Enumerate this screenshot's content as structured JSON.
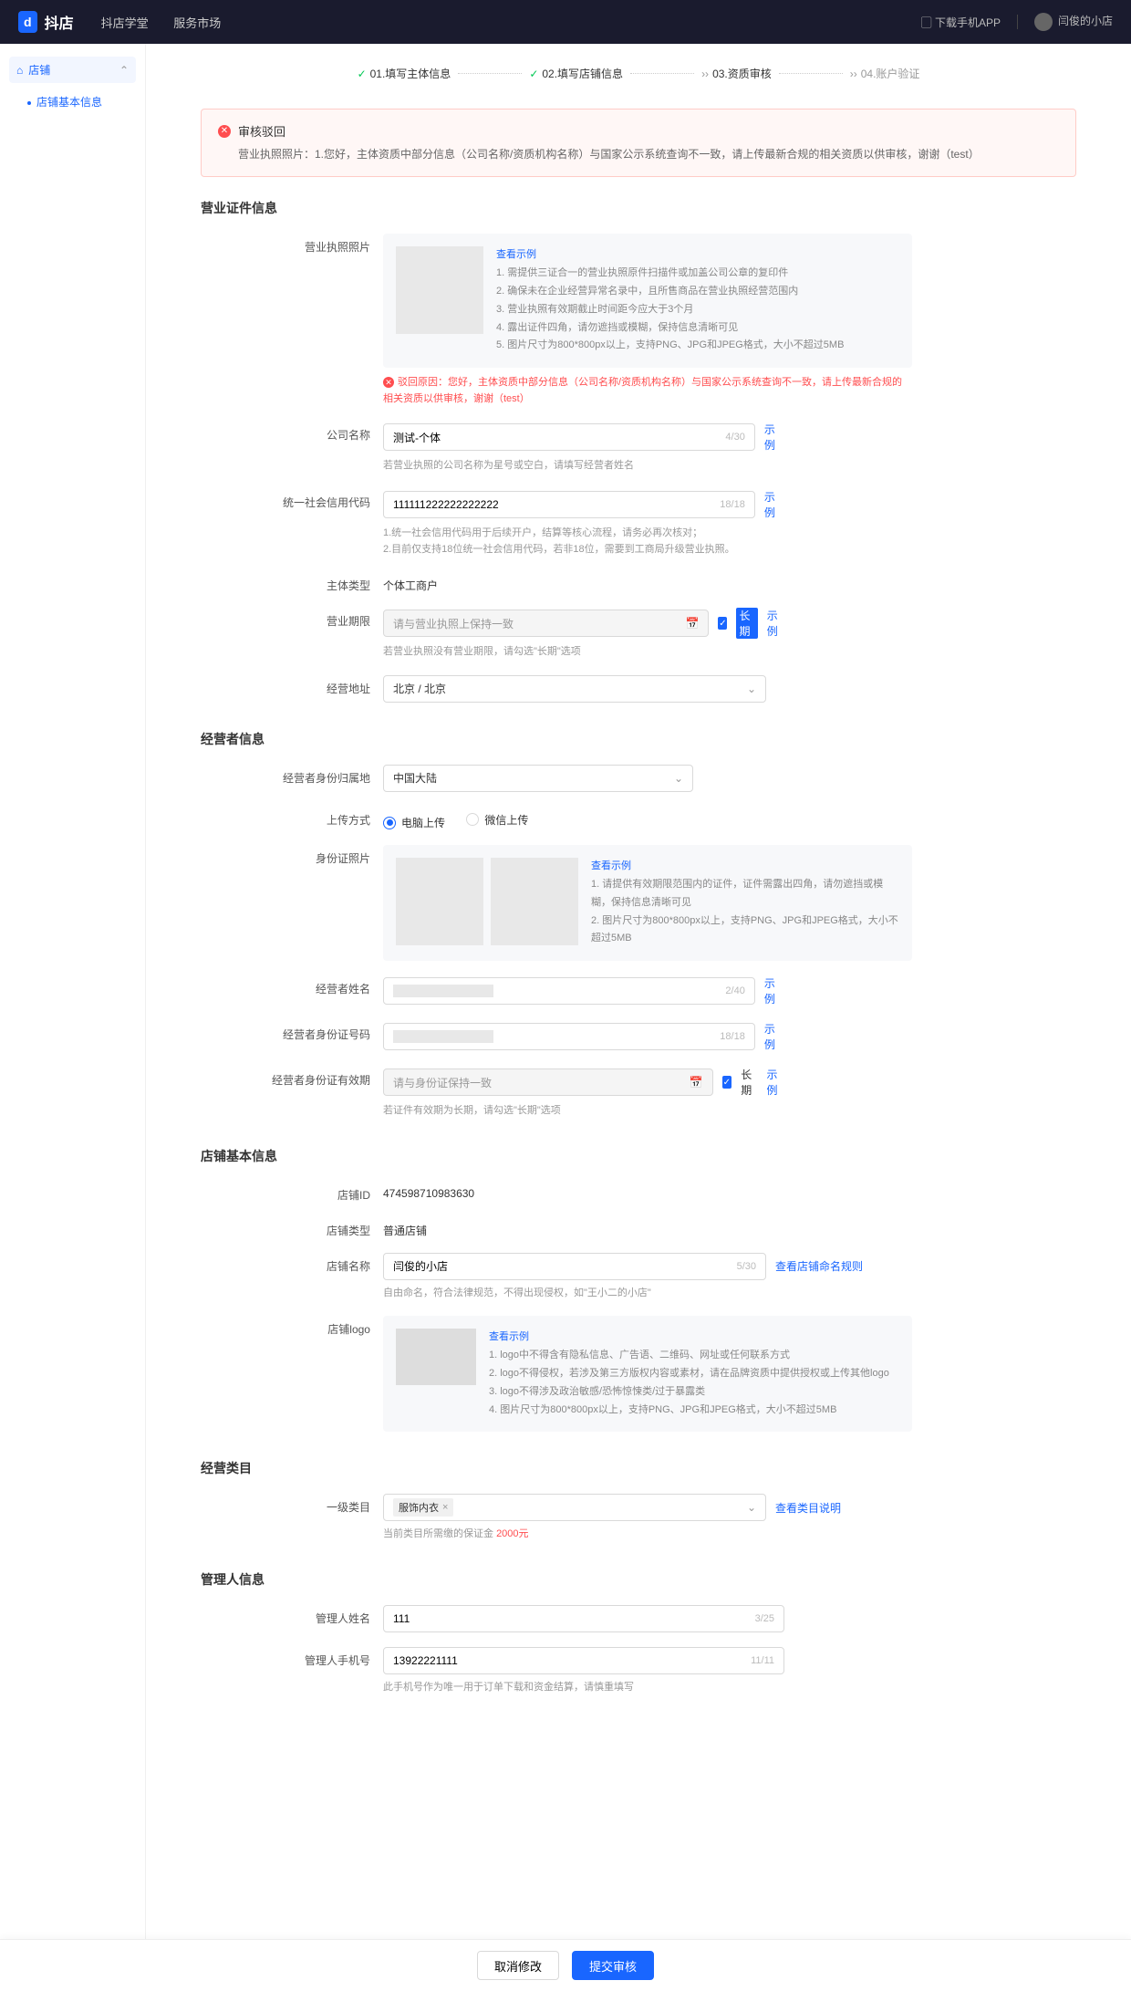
{
  "topbar": {
    "brand": "抖店",
    "nav": [
      "抖店学堂",
      "服务市场"
    ],
    "download": "下载手机APP",
    "shopName": "闫俊的小店"
  },
  "sidebar": {
    "group": "店铺",
    "item": "店铺基本信息"
  },
  "steps": {
    "s1": "01.填写主体信息",
    "s2": "02.填写店铺信息",
    "s3": "03.资质审核",
    "s4": "04.账户验证"
  },
  "alert": {
    "title": "审核驳回",
    "body": "营业执照照片：1.您好，主体资质中部分信息（公司名称/资质机构名称）与国家公示系统查询不一致，请上传最新合规的相关资质以供审核，谢谢（test）"
  },
  "license": {
    "sectionTitle": "营业证件信息",
    "photoLabel": "营业执照照片",
    "exampleLink": "查看示例",
    "tips": [
      "1. 需提供三证合一的营业执照原件扫描件或加盖公司公章的复印件",
      "2. 确保未在企业经营异常名录中，且所售商品在营业执照经营范围内",
      "3. 营业执照有效期截止时间距今应大于3个月",
      "4. 露出证件四角，请勿遮挡或模糊，保持信息清晰可见",
      "5. 图片尺寸为800*800px以上，支持PNG、JPG和JPEG格式，大小不超过5MB"
    ],
    "rejectReason": "驳回原因：您好，主体资质中部分信息（公司名称/资质机构名称）与国家公示系统查询不一致，请上传最新合规的相关资质以供审核，谢谢（test）",
    "companyNameLabel": "公司名称",
    "companyNameValue": "测试-个体",
    "companyNameCount": "4/30",
    "companyNameExample": "示例",
    "companyNameHelp": "若营业执照的公司名称为星号或空白，请填写经营者姓名",
    "creditCodeLabel": "统一社会信用代码",
    "creditCodeValue": "111111222222222222",
    "creditCodeCount": "18/18",
    "creditCodeExample": "示例",
    "creditCodeHelp": "1.统一社会信用代码用于后续开户，结算等核心流程，请务必再次核对；\n2.目前仅支持18位统一社会信用代码，若非18位，需要到工商局升级营业执照。",
    "entityTypeLabel": "主体类型",
    "entityTypeValue": "个体工商户",
    "bizPeriodLabel": "营业期限",
    "bizPeriodPlaceholder": "请与营业执照上保持一致",
    "bizPeriodLongterm": "长期",
    "bizPeriodExample": "示例",
    "bizPeriodHelp": "若营业执照没有营业期限，请勾选\"长期\"选项",
    "bizAddrLabel": "经营地址",
    "bizAddrValue": "北京 / 北京"
  },
  "operator": {
    "sectionTitle": "经营者信息",
    "idRegionLabel": "经营者身份归属地",
    "idRegionValue": "中国大陆",
    "uploadMethodLabel": "上传方式",
    "uploadPc": "电脑上传",
    "uploadWx": "微信上传",
    "idPhotoLabel": "身份证照片",
    "idExampleLink": "查看示例",
    "idTips": [
      "1. 请提供有效期限范围内的证件，证件需露出四角，请勿遮挡或模糊，保持信息清晰可见",
      "2. 图片尺寸为800*800px以上，支持PNG、JPG和JPEG格式，大小不超过5MB"
    ],
    "nameLabel": "经营者姓名",
    "nameCount": "2/40",
    "nameExample": "示例",
    "idNoLabel": "经营者身份证号码",
    "idNoCount": "18/18",
    "idNoExample": "示例",
    "idValidLabel": "经营者身份证有效期",
    "idValidPlaceholder": "请与身份证保持一致",
    "idValidLongterm": "长期",
    "idValidExample": "示例",
    "idValidHelp": "若证件有效期为长期，请勾选\"长期\"选项"
  },
  "shop": {
    "sectionTitle": "店铺基本信息",
    "idLabel": "店铺ID",
    "idValue": "474598710983630",
    "typeLabel": "店铺类型",
    "typeValue": "普通店铺",
    "nameLabel": "店铺名称",
    "nameValue": "闫俊的小店",
    "nameCount": "5/30",
    "nameRuleLink": "查看店铺命名规则",
    "nameHelp": "自由命名，符合法律规范，不得出现侵权，如\"王小二的小店\"",
    "logoLabel": "店铺logo",
    "logoExampleLink": "查看示例",
    "logoTips": [
      "1. logo中不得含有隐私信息、广告语、二维码、网址或任何联系方式",
      "2. logo不得侵权，若涉及第三方版权内容或素材，请在品牌资质中提供授权或上传其他logo",
      "3. logo不得涉及政治敏感/恐怖惊悚类/过于暴露类",
      "4. 图片尺寸为800*800px以上，支持PNG、JPG和JPEG格式，大小不超过5MB"
    ]
  },
  "category": {
    "sectionTitle": "经营类目",
    "primaryLabel": "一级类目",
    "tag": "服饰内衣",
    "detailLink": "查看类目说明",
    "depositText": "当前类目所需缴的保证金 ",
    "depositAmount": "2000元"
  },
  "admin": {
    "sectionTitle": "管理人信息",
    "nameLabel": "管理人姓名",
    "nameValue": "111",
    "nameCount": "3/25",
    "phoneLabel": "管理人手机号",
    "phoneValue": "13922221111",
    "phoneCount": "11/11",
    "phoneHelp": "此手机号作为唯一用于订单下载和资金结算，请慎重填写"
  },
  "footer": {
    "cancel": "取消修改",
    "submit": "提交审核"
  }
}
